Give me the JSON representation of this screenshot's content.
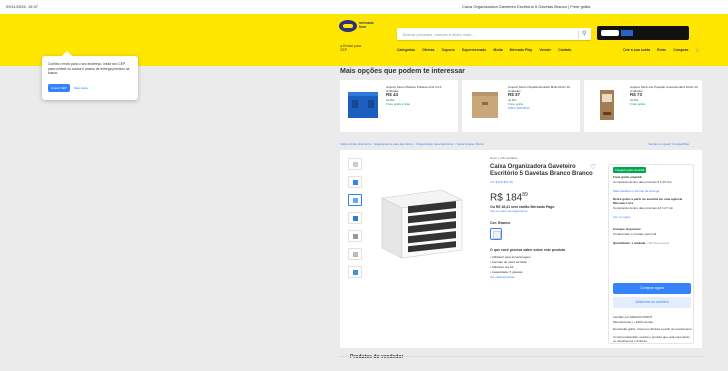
{
  "window": {
    "timestamp": "09/11/2026, 19:37",
    "doc_title": "Caixa Organizadora Gaveteiro Escritório 5 Gavetas Branco | Frete grátis"
  },
  "header": {
    "logo_text": "mercado livre",
    "search_placeholder": "Buscar produtos, marcas e muito mais...",
    "location_label": "Enviar para",
    "location_value": "CEP",
    "nav": [
      "Categorias",
      "Ofertas",
      "Cupons",
      "Supermercado",
      "Moda",
      "Mercado Play",
      "Vender",
      "Contato"
    ],
    "nav_right": [
      "Crie a sua conta",
      "Entre",
      "Compras"
    ],
    "cart_icon": "cart-icon"
  },
  "tooltip": {
    "message": "Confira o envio para o seu endereço. Insira seu CEP para conferir os custos e prazos de entrega precisos na busca.",
    "primary": "Inserir CEP",
    "secondary": "Mais tarde"
  },
  "recommendations": {
    "title": "Mais opções que podem te interessar",
    "cards": [
      {
        "name": "Arquivo Morto Plástico Polibras Azul C/10 Unidades",
        "price": "R$ 44",
        "note": "no Pix",
        "ship": "Frete grátis 2 dias",
        "link": ""
      },
      {
        "name": "Arquivo Morto Papelão Ecofácil Multi-Ofício 10 Unidades",
        "price": "R$ 37",
        "note": "no Pix",
        "ship": "Frete grátis",
        "link": "MAIS VENDIDO"
      },
      {
        "name": "Arquivo Morto De Papelão Caixa Ecofácil Ofício 10 Unidades",
        "price": "R$ 73",
        "note": "no Pix",
        "ship": "Frete grátis",
        "link": ""
      }
    ]
  },
  "breadcrumb": {
    "left": "Voltar à lista  |  Escritório > Equipamento para Escritório > Organização para Escritório > Caixa Arquivo Morto",
    "right": "Vender um igual  |  Compartilhar"
  },
  "product": {
    "condition": "Novo  |  +50 vendidos",
    "title": "Caixa Organizadora Gaveteiro Escritório 5 Gavetas Branco Branco",
    "rating": "4.6 ★★★★★ (8)",
    "price": "R$ 184",
    "price_cents": "89",
    "installments": "Ou R$ 18,41 sem cartão Mercado Pago",
    "installments_link": "Ver os meios de pagamento",
    "color_label": "Cor: Branco",
    "need_title": "O que você precisa saber sobre este produto",
    "features": [
      "Utilizável para armazenagem",
      "Formato de caixa fechada",
      "Utilizável pra A4",
      "Capacidade: 5 gavetas"
    ],
    "more_link": "Ver características"
  },
  "buybox": {
    "badge": "Chegará grátis amanhã",
    "free_ship": "Frete grátis amanhã",
    "ship_note": "Comprando dentro das próximas 9 h 45 min",
    "ship_link": "Mais detalhes e formas de entrega",
    "pickup": "Retire grátis a partir de amanhã em uma agência Mercado Livre",
    "pickup_note": "Comprando dentro das próximas 12 h 27 min",
    "pickup_link": "Ver no mapa",
    "stock": "Estoque disponível",
    "stock_note": "Armazenado e enviado pelo Full",
    "qty": "Quantidade: 1 unidade",
    "qty_note": "(+50 disponíveis)",
    "buy": "Comprar agora",
    "cart": "Adicionar ao carrinho",
    "seller": "Vendido por AMAZON PRINT",
    "seller_note": "MercadoLíder | +1000 vendas",
    "return": "Devolução grátis. Você tem 30 dias a partir do recebimento.",
    "protect": "Compra Garantida, receba o produto que está esperando ou devolvemos o dinheiro."
  },
  "seller_section": {
    "title": "Produtos do vendedor"
  }
}
